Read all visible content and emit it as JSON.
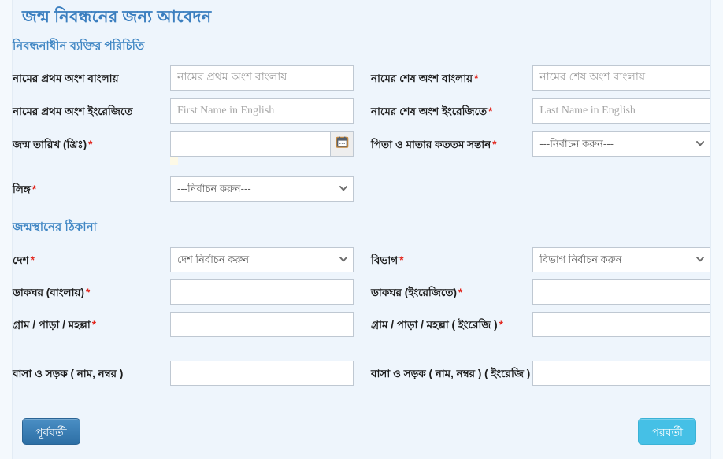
{
  "page": {
    "title": "জন্ম নিবন্ধনের জন্য আবেদন"
  },
  "sections": {
    "person": "নিবন্ধনাধীন ব্যক্তির পরিচিতি",
    "address": "জন্মস্থানের ঠিকানা"
  },
  "fields": {
    "first_name_bn": {
      "label": "নামের প্রথম অংশ বাংলায়",
      "required": false,
      "placeholder": "নামের প্রথম অংশ বাংলায়",
      "value": ""
    },
    "last_name_bn": {
      "label": "নামের শেষ অংশ বাংলায়",
      "required": true,
      "required_mark": "*",
      "placeholder": "নামের শেষ অংশ বাংলায়",
      "value": ""
    },
    "first_name_en": {
      "label": "নামের প্রথম অংশ ইংরেজিতে",
      "required": false,
      "placeholder": "First Name in English",
      "value": ""
    },
    "last_name_en": {
      "label": "নামের শেষ অংশ ইংরেজিতে",
      "required": true,
      "required_mark": "*",
      "placeholder": "Last Name in English",
      "value": ""
    },
    "birth_date": {
      "label": "জন্ম তারিখ (খ্রিঃ)",
      "required": true,
      "required_mark": "*",
      "placeholder": "",
      "value": "",
      "icon": "calendar-icon"
    },
    "birth_order": {
      "label": "পিতা ও মাতার কততম সন্তান",
      "required": true,
      "required_mark": "*",
      "selected": "---নির্বাচন করুন---"
    },
    "gender": {
      "label": "লিঙ্গ",
      "required": true,
      "required_mark": "*",
      "selected": "---নির্বাচন করুন---"
    },
    "country": {
      "label": "দেশ",
      "required": true,
      "required_mark": "*",
      "selected": "দেশ নির্বাচন করুন"
    },
    "division": {
      "label": "বিভাগ",
      "required": true,
      "required_mark": "*",
      "selected": "বিভাগ নির্বাচন করুন"
    },
    "post_office_bn": {
      "label": "ডাকঘর (বাংলায়)",
      "required": true,
      "required_mark": "*",
      "placeholder": "",
      "value": ""
    },
    "post_office_en": {
      "label": "ডাকঘর (ইংরেজিতে)",
      "required": true,
      "required_mark": "*",
      "placeholder": "",
      "value": ""
    },
    "village_bn": {
      "label": "গ্রাম / পাড়া / মহল্লা",
      "required": true,
      "required_mark": "*",
      "placeholder": "",
      "value": ""
    },
    "village_en": {
      "label": "গ্রাম / পাড়া / মহল্লা ( ইংরেজি )",
      "required": true,
      "required_mark": "*",
      "placeholder": "",
      "value": ""
    },
    "road_bn": {
      "label": "বাসা ও সড়ক ( নাম, নম্বর )",
      "required": false,
      "placeholder": "",
      "value": ""
    },
    "road_en": {
      "label": "বাসা ও সড়ক ( নাম, নম্বর ) ( ইংরেজি )",
      "required": false,
      "placeholder": "",
      "value": ""
    }
  },
  "buttons": {
    "previous": "পূর্ববর্তী",
    "next": "পরবর্তী"
  },
  "colors": {
    "page_bg": "#eef5fc",
    "title_blue": "#3a7ebf",
    "section_blue": "#4187c4",
    "required_red": "#e2231a",
    "prev_button": "#2d6fa5",
    "next_button": "#45c0e6",
    "input_border": "#bfc8d2"
  }
}
